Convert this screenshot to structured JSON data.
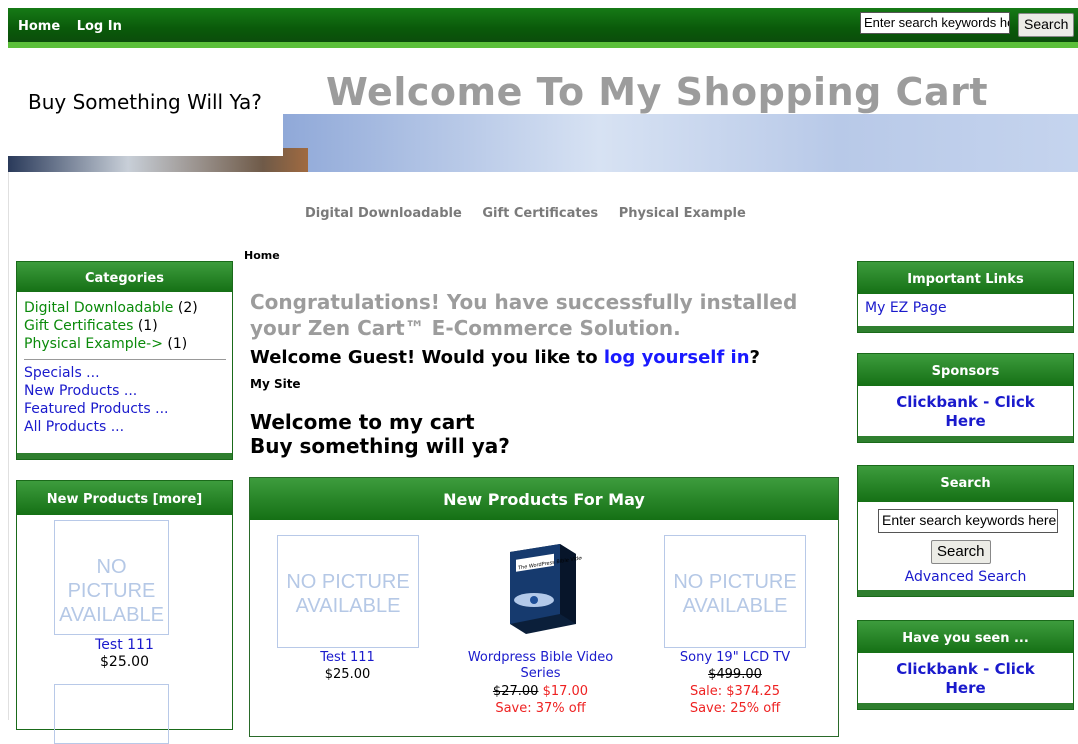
{
  "topbar": {
    "nav": [
      "Home",
      "Log In"
    ],
    "search_placeholder": "Enter search keywords here",
    "search_button": "Search"
  },
  "header": {
    "tagline": "Buy Something Will Ya?",
    "title": "Welcome To My Shopping Cart"
  },
  "catnav": [
    "Digital Downloadable",
    "Gift Certificates",
    "Physical Example"
  ],
  "breadcrumb": "Home",
  "categories": {
    "title": "Categories",
    "items": [
      {
        "label": "Digital Downloadable",
        "count": "(2)"
      },
      {
        "label": "Gift Certificates",
        "count": "(1)"
      },
      {
        "label": "Physical Example->",
        "count": "(1)"
      }
    ],
    "links": [
      "Specials ...",
      "New Products ...",
      "Featured Products ...",
      "All Products ..."
    ]
  },
  "new_products_side": {
    "title": "New Products  [more]",
    "product": {
      "image": "NO PICTURE AVAILABLE",
      "name": "Test 111",
      "price": "$25.00"
    }
  },
  "main": {
    "congrats": "Congratulations! You have successfully installed your Zen Cart™ E-Commerce Solution.",
    "welcome_prefix": "Welcome Guest! Would you like to ",
    "welcome_link": "log yourself in",
    "welcome_suffix": "?",
    "site_label": "My Site",
    "greeting_line1": "Welcome to my cart",
    "greeting_line2": "Buy something will ya?",
    "new_products_title": "New Products For May",
    "products": [
      {
        "image": "NO PICTURE AVAILABLE",
        "name": "Test 111",
        "price": "$25.00"
      },
      {
        "image_label": "The WordPress Bible Video Series",
        "name": "Wordpress Bible Video Series",
        "old_price": "$27.00",
        "price": "$17.00",
        "save": "Save: 37% off"
      },
      {
        "image": "NO PICTURE AVAILABLE",
        "name": "Sony 19\" LCD TV",
        "old_price": "$499.00",
        "sale": "Sale: $374.25",
        "save": "Save: 25% off"
      }
    ]
  },
  "right": {
    "important_title": "Important Links",
    "important_link": "My EZ Page",
    "sponsors_title": "Sponsors",
    "sponsors_link": "Clickbank - Click Here",
    "search_title": "Search",
    "search_placeholder": "Enter search keywords here",
    "search_button": "Search",
    "advanced_search": "Advanced Search",
    "seen_title": "Have you seen ...",
    "seen_link": "Clickbank - Click Here"
  },
  "colors": {
    "header_green": "#0a5a0a",
    "accent_green": "#5bbf3a",
    "link_blue": "#1a1aff",
    "title_gray": "#9c9c9c"
  }
}
